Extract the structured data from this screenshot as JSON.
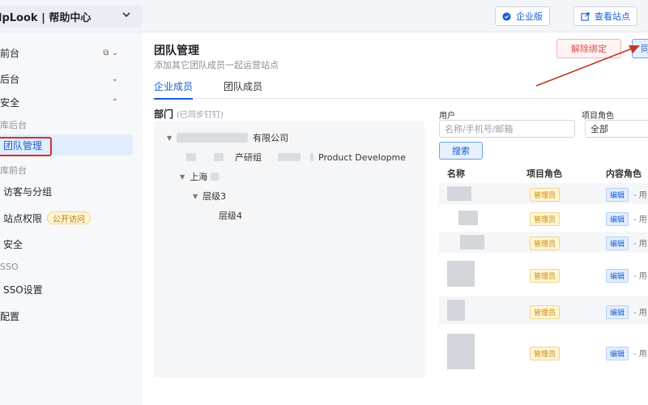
{
  "topbar": {
    "brand": "lpLook | 帮助中心",
    "enterprise_label": "企业版",
    "view_site_label": "查看站点"
  },
  "sidebar": {
    "items": [
      {
        "label": "前台"
      },
      {
        "label": "后台"
      },
      {
        "label": "安全"
      },
      {
        "label": "库后台"
      },
      {
        "label": "团队管理"
      },
      {
        "label": "库前台"
      },
      {
        "label": "访客与分组"
      },
      {
        "label": "站点权限"
      },
      {
        "label": "安全"
      },
      {
        "label": "SSO"
      },
      {
        "label": "SSO设置"
      },
      {
        "label": "配置"
      }
    ],
    "public_tag": "公开访问"
  },
  "main": {
    "title": "团队管理",
    "subtitle": "添加其它团队成员一起运营站点",
    "unbind_label": "解除绑定",
    "sync_label": "同",
    "tabs": [
      {
        "label": "企业成员"
      },
      {
        "label": "团队成员"
      }
    ],
    "dept": {
      "title": "部门",
      "hint": "(已同步钉钉)",
      "company_suffix": "有限公司",
      "product_group": "产研组",
      "product_dev": "Product Developme",
      "shanghai": "上海",
      "level3": "层级3",
      "level4": "层级4"
    },
    "filters": {
      "user_label": "用户",
      "user_placeholder": "名称/手机号/邮箱",
      "role_label": "项目角色",
      "role_value": "全部",
      "search_label": "搜索"
    },
    "table": {
      "headers": [
        "名称",
        "项目角色",
        "内容角色"
      ],
      "rows": [
        {
          "role": "管理员",
          "content_role": "编辑",
          "tail": "- 用"
        },
        {
          "role": "管理员",
          "content_role": "编辑",
          "tail": "- 用"
        },
        {
          "role": "管理员",
          "content_role": "编辑",
          "tail": "- 用"
        },
        {
          "role": "管理员",
          "content_role": "编辑",
          "tail": "- 用"
        },
        {
          "role": "管理员",
          "content_role": "编辑",
          "tail": "- 用"
        },
        {
          "role": "管理员",
          "content_role": "编辑",
          "tail": "- 用"
        }
      ]
    }
  },
  "colors": {
    "accent": "#1a5fd0",
    "danger": "#d93025",
    "annotation_arrow": "#c0392b"
  }
}
